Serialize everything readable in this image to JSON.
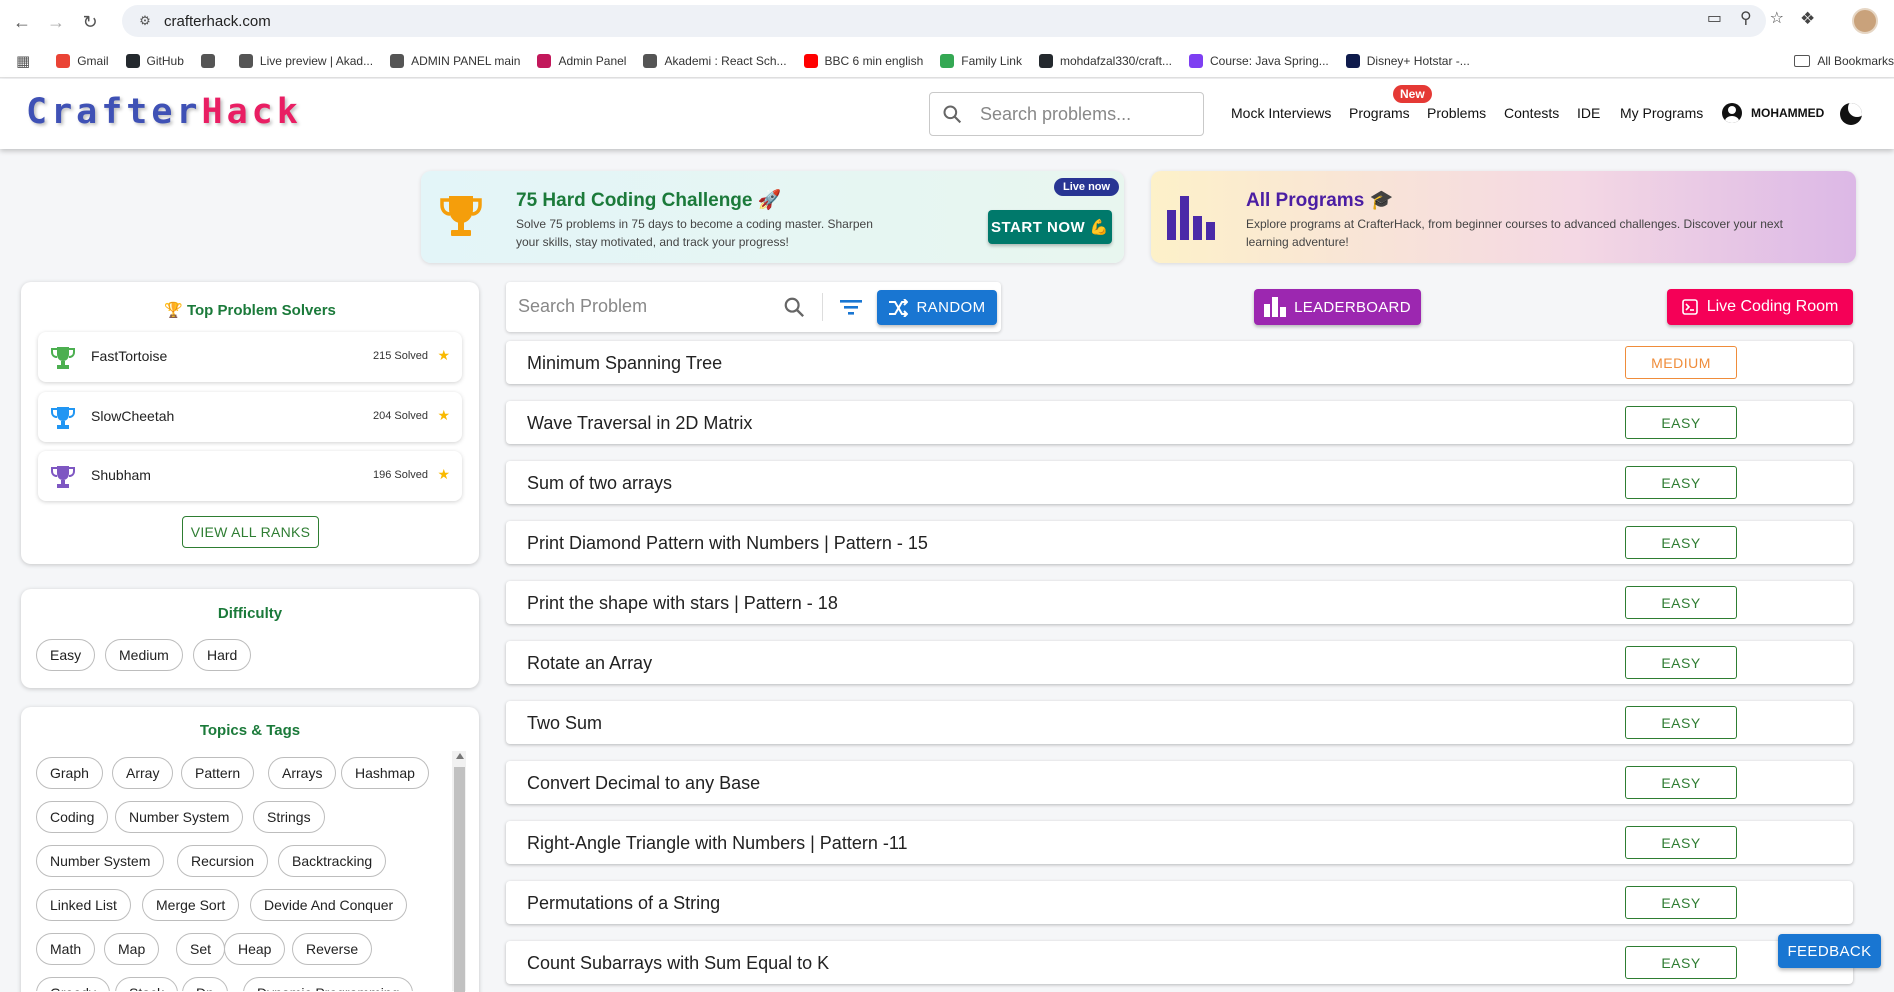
{
  "browser": {
    "url": "crafterhack.com",
    "bookmarks": [
      {
        "label": "Gmail",
        "color": "#ea4335"
      },
      {
        "label": "GitHub",
        "color": "#24292e"
      },
      {
        "label": "",
        "color": "#555555"
      },
      {
        "label": "Live preview | Akad...",
        "color": "#555555"
      },
      {
        "label": "ADMIN PANEL main",
        "color": "#555555"
      },
      {
        "label": "Admin Panel",
        "color": "#c2185b"
      },
      {
        "label": "Akademi : React Sch...",
        "color": "#555555"
      },
      {
        "label": "BBC 6 min english",
        "color": "#ff0000"
      },
      {
        "label": "Family Link",
        "color": "#34a853"
      },
      {
        "label": "mohdafzal330/craft...",
        "color": "#24292e"
      },
      {
        "label": "Course: Java Spring...",
        "color": "#7e3ff2"
      },
      {
        "label": "Disney+ Hotstar -...",
        "color": "#0f1b4c"
      }
    ],
    "all_bookmarks": "All Bookmarks"
  },
  "header": {
    "logo_part1": "Crafter",
    "logo_part2": "Hack",
    "search_placeholder": "Search problems...",
    "nav": {
      "mock": "Mock Interviews",
      "programs": "Programs",
      "new_badge": "New",
      "problems": "Problems",
      "contests": "Contests",
      "ide": "IDE",
      "my_programs": "My Programs"
    },
    "username": "MOHAMMED"
  },
  "banners": {
    "challenge": {
      "title": "75 Hard Coding Challenge 🚀",
      "desc_line1": "Solve 75 problems in 75 days to become a coding master. Sharpen",
      "desc_line2": "your skills, stay motivated, and track your progress!",
      "live_badge": "Live now",
      "cta": "START NOW 💪"
    },
    "programs": {
      "title": "All Programs 🎓",
      "desc_line1": "Explore programs at CrafterHack, from beginner courses to advanced challenges. Discover your next",
      "desc_line2": "learning adventure!"
    }
  },
  "top_solvers": {
    "title": "Top Problem Solvers",
    "items": [
      {
        "name": "FastTortoise",
        "solved": "215 Solved",
        "color": "#4caf50"
      },
      {
        "name": "SlowCheetah",
        "solved": "204 Solved",
        "color": "#2196f3"
      },
      {
        "name": "Shubham",
        "solved": "196 Solved",
        "color": "#7e57c2"
      }
    ],
    "view_all": "VIEW ALL RANKS"
  },
  "difficulty": {
    "title": "Difficulty",
    "options": [
      "Easy",
      "Medium",
      "Hard"
    ]
  },
  "topics": {
    "title": "Topics & Tags",
    "rows": [
      [
        "Graph",
        "Array",
        "Pattern",
        "Arrays",
        "Hashmap"
      ],
      [
        "Coding",
        "Number System",
        "Strings"
      ],
      [
        "Number System",
        "Recursion",
        "Backtracking"
      ],
      [
        "Linked List",
        "Merge Sort",
        "Devide And Conquer"
      ],
      [
        "Math",
        "Map",
        "Set",
        "Heap",
        "Reverse"
      ],
      [
        "Greedy",
        "Stack",
        "Dp",
        "Dynamic Programming"
      ]
    ]
  },
  "toolbar": {
    "search_placeholder": "Search Problem",
    "random": "RANDOM",
    "leaderboard": "LEADERBOARD",
    "live_room": "Live Coding Room"
  },
  "problems": [
    {
      "title": "Minimum Spanning Tree",
      "difficulty": "MEDIUM"
    },
    {
      "title": "Wave Traversal in 2D Matrix",
      "difficulty": "EASY"
    },
    {
      "title": "Sum of two arrays",
      "difficulty": "EASY"
    },
    {
      "title": "Print Diamond Pattern with Numbers | Pattern - 15",
      "difficulty": "EASY"
    },
    {
      "title": "Print the shape with stars | Pattern - 18",
      "difficulty": "EASY"
    },
    {
      "title": "Rotate an Array",
      "difficulty": "EASY"
    },
    {
      "title": "Two Sum",
      "difficulty": "EASY"
    },
    {
      "title": "Convert Decimal to any Base",
      "difficulty": "EASY"
    },
    {
      "title": "Right-Angle Triangle with Numbers | Pattern -11",
      "difficulty": "EASY"
    },
    {
      "title": "Permutations of a String",
      "difficulty": "EASY"
    },
    {
      "title": "Count Subarrays with Sum Equal to K",
      "difficulty": "EASY"
    }
  ],
  "feedback": "FEEDBACK",
  "colors": {
    "accent_blue": "#1976d2",
    "accent_purple": "#9c27b0",
    "accent_pink": "#f50057",
    "easy_green": "#2e7d32",
    "medium_orange": "#ef8c3a"
  }
}
